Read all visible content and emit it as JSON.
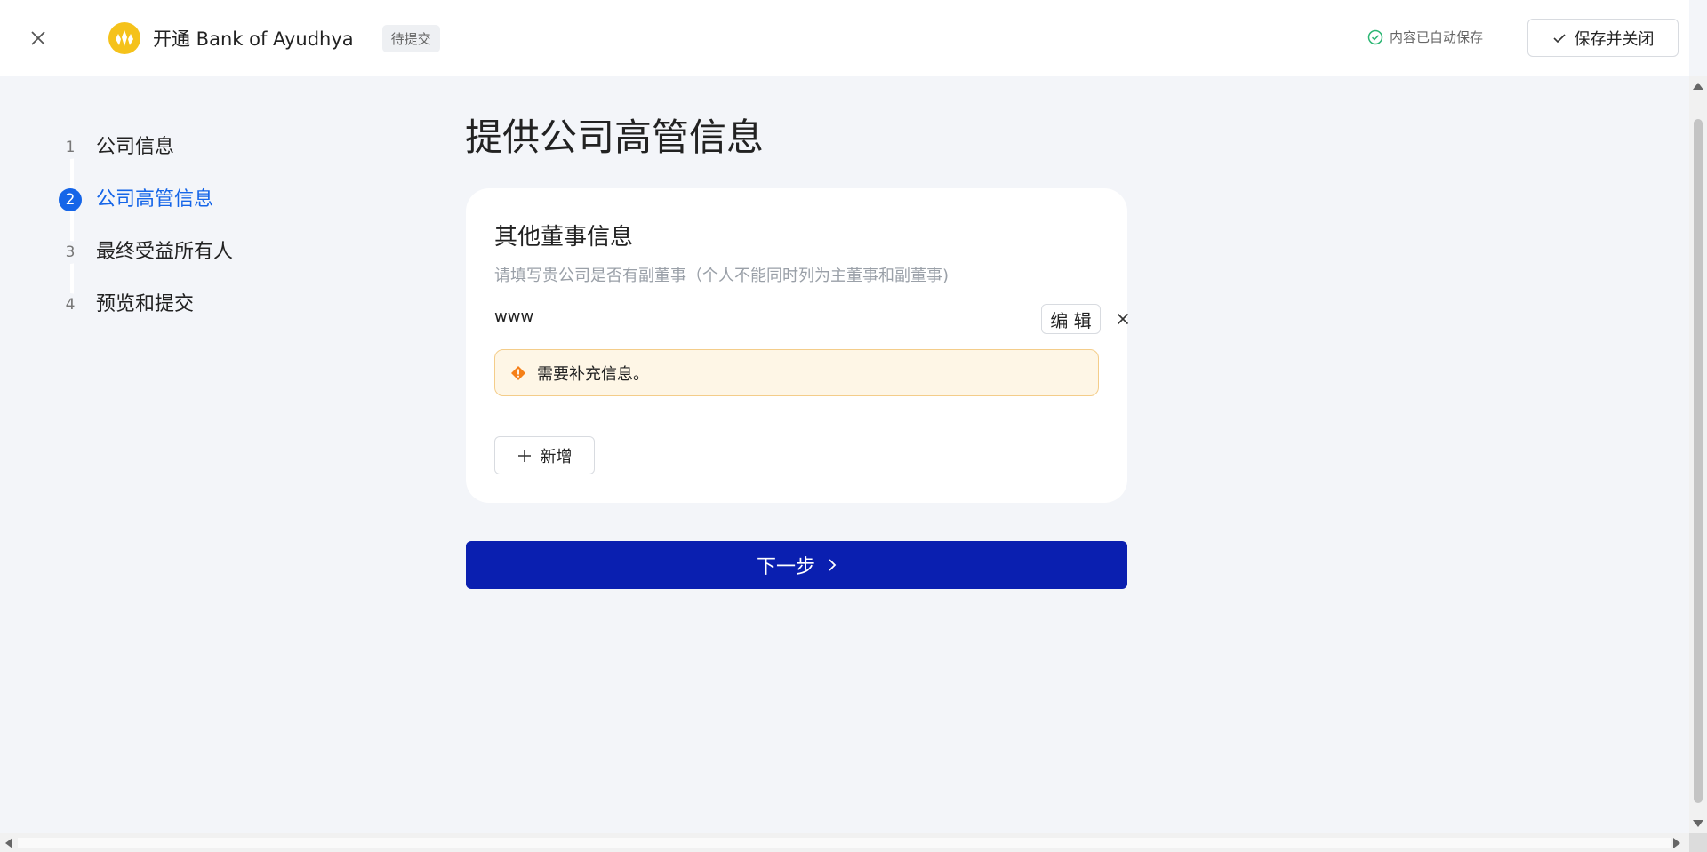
{
  "header": {
    "close_icon": "close-icon",
    "brand_title": "开通 Bank of Ayudhya",
    "status_tag": "待提交",
    "autosave_text": "内容已自动保存",
    "save_close_label": "保存并关闭",
    "brand_color": "#f5c21b"
  },
  "stepper": {
    "steps": [
      {
        "number": "1",
        "label": "公司信息",
        "active": false
      },
      {
        "number": "2",
        "label": "公司高管信息",
        "active": true
      },
      {
        "number": "3",
        "label": "最终受益所有人",
        "active": false
      },
      {
        "number": "4",
        "label": "预览和提交",
        "active": false
      }
    ],
    "active_color": "#1565e8"
  },
  "main": {
    "page_title": "提供公司高管信息",
    "card": {
      "title": "其他董事信息",
      "description": "请填写贵公司是否有副董事（个人不能同时列为主董事和副董事)",
      "director": {
        "name": "www",
        "edit_label": "编 辑"
      },
      "warning": "需要补充信息。",
      "add_label": "新增"
    },
    "next_label": "下一步",
    "next_color": "#0a1fb0"
  }
}
